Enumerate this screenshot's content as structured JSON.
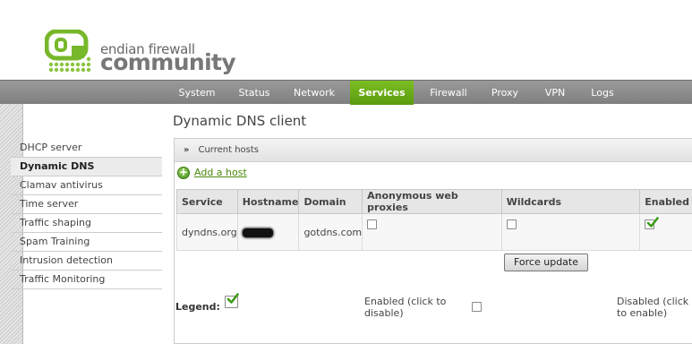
{
  "brand": {
    "line1": "endian firewall",
    "line2": "community"
  },
  "nav": {
    "items": [
      "System",
      "Status",
      "Network",
      "Services",
      "Firewall",
      "Proxy",
      "VPN",
      "Logs"
    ],
    "active": "Services"
  },
  "sidebar": {
    "items": [
      "DHCP server",
      "Dynamic DNS",
      "Clamav antivirus",
      "Time server",
      "Traffic shaping",
      "Spam Training",
      "Intrusion detection",
      "Traffic Monitoring"
    ],
    "active": "Dynamic DNS"
  },
  "page": {
    "title": "Dynamic DNS client"
  },
  "panel": {
    "arrows": "»",
    "title": "Current hosts",
    "add_link": "Add a host",
    "columns": [
      "Service",
      "Hostname",
      "Domain",
      "Anonymous web proxies",
      "Wildcards",
      "Enabled"
    ],
    "rows": [
      {
        "service": "dyndns.org",
        "hostname_redacted": true,
        "domain": "gotdns.com",
        "anonymous_web_proxies": false,
        "wildcards": false,
        "enabled": true
      }
    ],
    "force_update": "Force update"
  },
  "legend": {
    "label": "Legend:",
    "enabled_text": "Enabled (click to disable)",
    "disabled_text": "Disabled (click to enable)"
  },
  "colors": {
    "accent": "#6aae18",
    "nav_bg": "#8c8c8c",
    "link": "#4a8a0c"
  }
}
